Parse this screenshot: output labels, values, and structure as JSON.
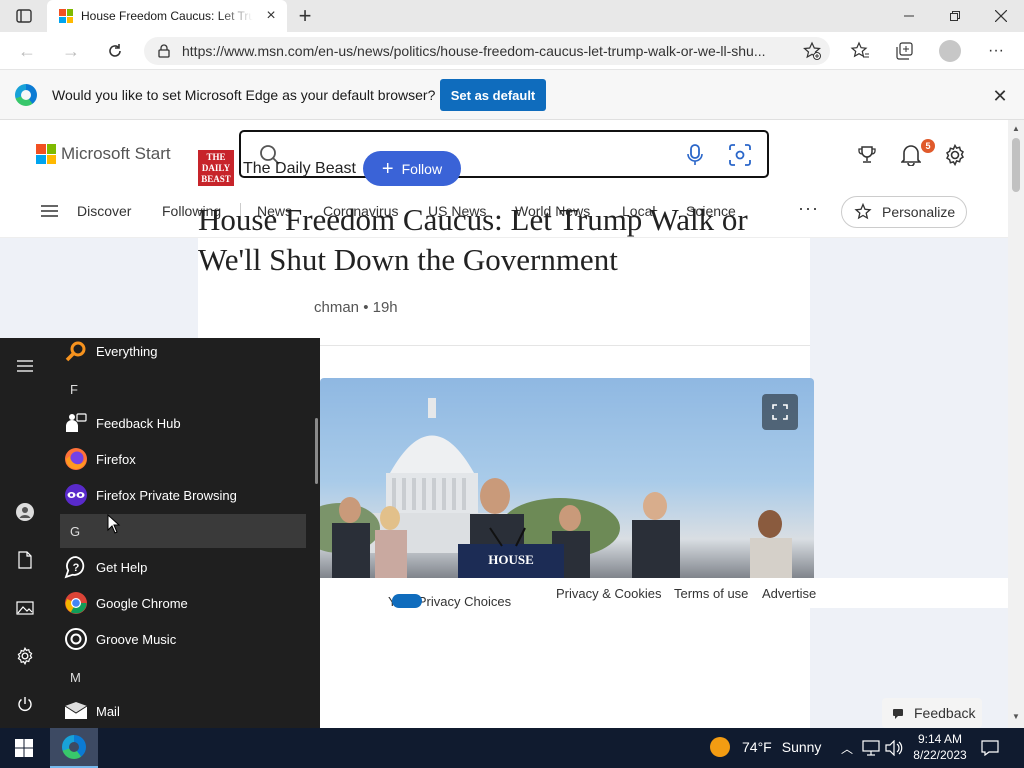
{
  "browser": {
    "tab": {
      "title": "House Freedom Caucus: Let Trump Walk or We'll Shut Down the Government"
    },
    "url": "https://www.msn.com/en-us/news/politics/house-freedom-caucus-let-trump-walk-or-we-ll-shu...",
    "infobar": {
      "message": "Would you like to set Microsoft Edge as your default browser?",
      "button_label": "Set as default"
    }
  },
  "msn": {
    "brand": "Microsoft Start",
    "notifications_count": "5",
    "nav": {
      "primary": [
        "Discover",
        "Following"
      ],
      "secondary": [
        "News",
        "Coronavirus",
        "US News",
        "World News",
        "Local",
        "Science"
      ],
      "more": "···",
      "personalize_label": "Personalize"
    },
    "article": {
      "publisher_logo_text": "THE DAILY BEAST",
      "publisher": "The Daily Beast",
      "follow_label": "Follow",
      "headline": "House Freedom Caucus: Let Trump Walk or We'll Shut Down the Government",
      "byline": "chman • 19h"
    },
    "footer": {
      "privacy": "Your Privacy Choices",
      "cookies": "Privacy & Cookies",
      "terms": "Terms of use",
      "advertise": "Advertise",
      "feedback": "Feedback"
    }
  },
  "startmenu": {
    "items": [
      {
        "type": "app",
        "name": "Everything",
        "icon": "search-orange-icon"
      },
      {
        "type": "letter",
        "name": "F"
      },
      {
        "type": "app",
        "name": "Feedback Hub",
        "icon": "feedback-hub-icon"
      },
      {
        "type": "app",
        "name": "Firefox",
        "icon": "firefox-icon"
      },
      {
        "type": "app",
        "name": "Firefox Private Browsing",
        "icon": "firefox-private-icon"
      },
      {
        "type": "letter",
        "name": "G"
      },
      {
        "type": "app",
        "name": "Get Help",
        "icon": "get-help-icon"
      },
      {
        "type": "app",
        "name": "Google Chrome",
        "icon": "chrome-icon"
      },
      {
        "type": "app",
        "name": "Groove Music",
        "icon": "groove-music-icon"
      },
      {
        "type": "letter",
        "name": "M"
      },
      {
        "type": "app",
        "name": "Mail",
        "icon": "mail-icon"
      }
    ]
  },
  "taskbar": {
    "temperature": "74°F",
    "condition": "Sunny",
    "time": "9:14 AM",
    "date": "8/22/2023"
  },
  "colors": {
    "accent": "#0f6cbd",
    "follow": "#3a63d7",
    "daily_beast_red": "#c7242a",
    "taskbar": "#101b2f",
    "startmenu": "#1f1f1f"
  }
}
